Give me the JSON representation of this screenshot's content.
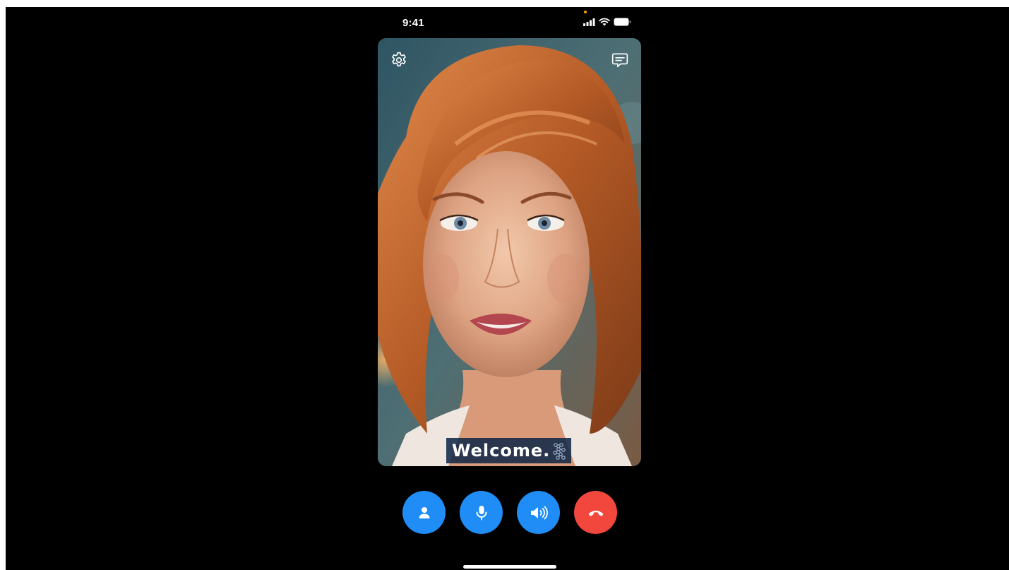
{
  "status_bar": {
    "time": "9:41",
    "signal_icon": "cellular-signal-icon",
    "wifi_icon": "wifi-icon",
    "battery_icon": "battery-icon"
  },
  "video": {
    "settings_icon": "gear-icon",
    "chat_icon": "chat-bubble-icon",
    "caption": "Welcome."
  },
  "controls": [
    {
      "name": "avatar-button",
      "icon": "person-icon",
      "color": "#1f8df5"
    },
    {
      "name": "microphone-button",
      "icon": "microphone-icon",
      "color": "#1f8df5"
    },
    {
      "name": "speaker-button",
      "icon": "speaker-icon",
      "color": "#1f8df5"
    },
    {
      "name": "end-call-button",
      "icon": "hang-up-icon",
      "color": "#f1473d"
    }
  ],
  "colors": {
    "background": "#000000",
    "accent_blue": "#1f8df5",
    "end_call_red": "#f1473d",
    "caption_bg": "#0a2346"
  }
}
